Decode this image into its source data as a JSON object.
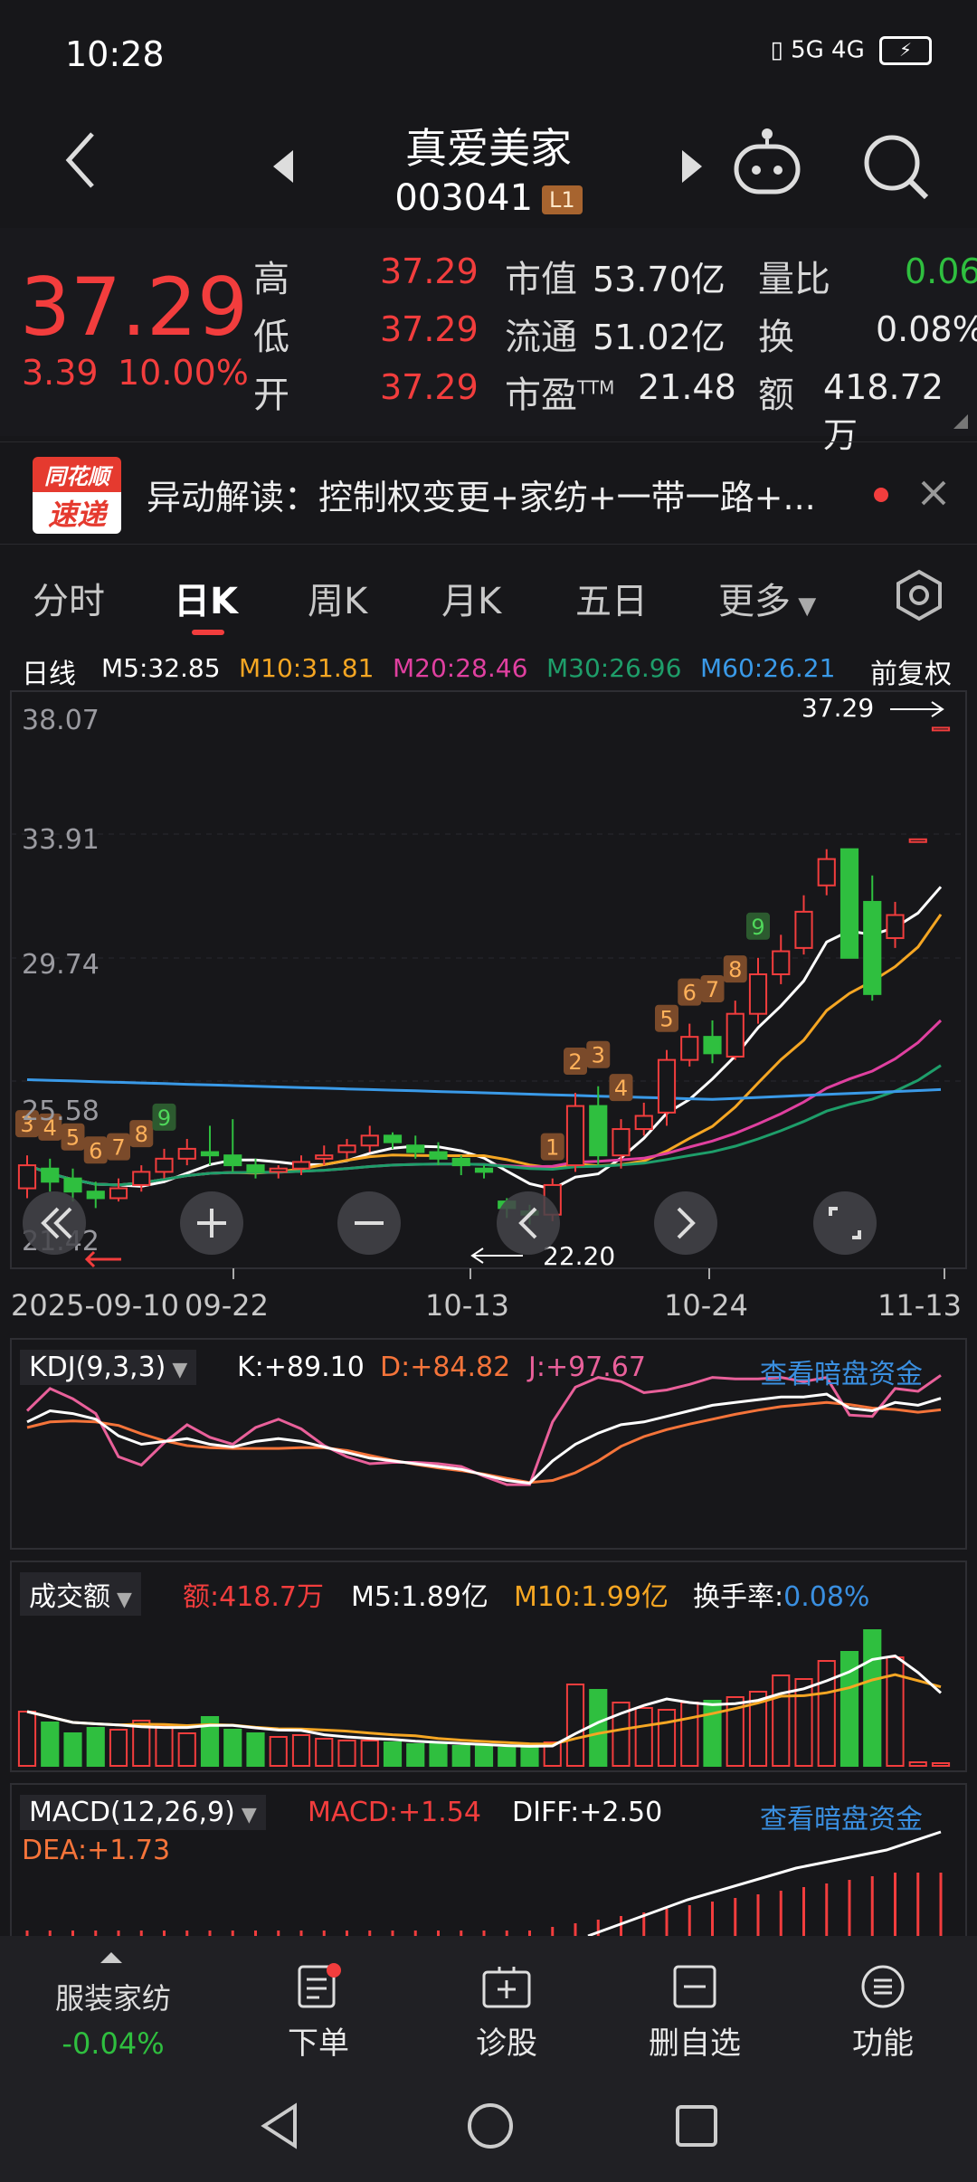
{
  "status": {
    "time": "10:28",
    "icons": "5G 4G"
  },
  "header": {
    "name": "真爱美家",
    "code": "003041",
    "badge": "L1"
  },
  "quote": {
    "price": "37.29",
    "change": "3.39",
    "change_pct": "10.00%",
    "rows": [
      {
        "l1": "高",
        "v1": "37.29",
        "l2": "市值",
        "v2": "53.70亿",
        "l3": "量比",
        "v3": "0.06"
      },
      {
        "l1": "低",
        "v1": "37.29",
        "l2": "流通",
        "v2": "51.02亿",
        "l3": "换",
        "v3": "0.08%"
      },
      {
        "l1": "开",
        "v1": "37.29",
        "l2": "市盈",
        "l2sup": "TTM",
        "v2": "21.48",
        "l3": "额",
        "v3": "418.72万"
      }
    ]
  },
  "news": {
    "brand_top": "同花顺",
    "brand_bottom": "速递",
    "text": "异动解读：控制权变更+家纺+一带一路+..."
  },
  "tabs": [
    "分时",
    "日K",
    "周K",
    "月K",
    "五日",
    "更多"
  ],
  "active_tab": "日K",
  "ma": {
    "label": "日线",
    "items": [
      {
        "text": "M5:32.85",
        "color": "#ffffff"
      },
      {
        "text": "M10:31.81",
        "color": "#f5a623"
      },
      {
        "text": "M20:28.46",
        "color": "#e040a0"
      },
      {
        "text": "M30:26.96",
        "color": "#1e9e6a"
      },
      {
        "text": "M60:26.21",
        "color": "#3a9ae8"
      }
    ],
    "adjust": "前复权"
  },
  "kchart": {
    "y_ticks": [
      "38.07",
      "33.91",
      "29.74",
      "25.58",
      "21.42"
    ],
    "x_ticks": [
      "2025-09-10",
      "09-22",
      "10-13",
      "10-24",
      "11-13"
    ],
    "high_label": "37.29",
    "low_label": "22.20"
  },
  "kdj": {
    "name": "KDJ(9,3,3)",
    "k": "K:+89.10",
    "d": "D:+84.82",
    "j": "J:+97.67",
    "link": "查看暗盘资金"
  },
  "volume": {
    "name": "成交额",
    "amount": "额:418.7万",
    "m5": "M5:1.89亿",
    "m10": "M10:1.99亿",
    "turnover_label": "换手率:",
    "turnover": "0.08%"
  },
  "macd": {
    "name": "MACD(12,26,9)",
    "macd": "MACD:+1.54",
    "diff": "DIFF:+2.50",
    "dea": "DEA:+1.73",
    "link": "查看暗盘资金"
  },
  "bottom_nav": {
    "sector": "服装家纺",
    "sector_change": "-0.04%",
    "items": [
      "下单",
      "诊股",
      "删自选",
      "功能"
    ]
  },
  "chart_data": {
    "type": "candlestick",
    "candles": [
      {
        "o": 23.3,
        "c": 24.0,
        "h": 24.3,
        "l": 23.0
      },
      {
        "o": 23.9,
        "c": 23.5,
        "h": 24.2,
        "l": 23.2
      },
      {
        "o": 23.6,
        "c": 23.2,
        "h": 23.9,
        "l": 22.9
      },
      {
        "o": 23.2,
        "c": 23.0,
        "h": 23.5,
        "l": 22.7
      },
      {
        "o": 23.0,
        "c": 23.3,
        "h": 23.6,
        "l": 22.9
      },
      {
        "o": 23.4,
        "c": 23.8,
        "h": 24.0,
        "l": 23.2
      },
      {
        "o": 23.8,
        "c": 24.2,
        "h": 24.5,
        "l": 23.6
      },
      {
        "o": 24.2,
        "c": 24.5,
        "h": 24.8,
        "l": 24.0
      },
      {
        "o": 24.4,
        "c": 24.3,
        "h": 25.2,
        "l": 24.0
      },
      {
        "o": 24.3,
        "c": 24.0,
        "h": 25.4,
        "l": 23.8
      },
      {
        "o": 24.0,
        "c": 23.8,
        "h": 24.2,
        "l": 23.6
      },
      {
        "o": 23.8,
        "c": 23.9,
        "h": 24.0,
        "l": 23.6
      },
      {
        "o": 23.9,
        "c": 24.1,
        "h": 24.3,
        "l": 23.7
      },
      {
        "o": 24.2,
        "c": 24.3,
        "h": 24.6,
        "l": 24.0
      },
      {
        "o": 24.4,
        "c": 24.6,
        "h": 24.8,
        "l": 24.2
      },
      {
        "o": 24.6,
        "c": 24.9,
        "h": 25.2,
        "l": 24.4
      },
      {
        "o": 24.9,
        "c": 24.7,
        "h": 25.0,
        "l": 24.5
      },
      {
        "o": 24.6,
        "c": 24.4,
        "h": 24.9,
        "l": 24.2
      },
      {
        "o": 24.4,
        "c": 24.2,
        "h": 24.7,
        "l": 24.0
      },
      {
        "o": 24.2,
        "c": 24.0,
        "h": 24.3,
        "l": 23.7
      },
      {
        "o": 23.9,
        "c": 23.8,
        "h": 24.0,
        "l": 23.6
      },
      {
        "o": 22.9,
        "c": 22.7,
        "h": 23.0,
        "l": 22.4
      },
      {
        "o": 22.6,
        "c": 22.5,
        "h": 22.8,
        "l": 22.2
      },
      {
        "o": 22.5,
        "c": 23.4,
        "h": 23.6,
        "l": 22.3
      },
      {
        "o": 24.0,
        "c": 25.8,
        "h": 26.2,
        "l": 23.8
      },
      {
        "o": 25.8,
        "c": 24.3,
        "h": 26.4,
        "l": 24.0
      },
      {
        "o": 24.3,
        "c": 25.1,
        "h": 25.4,
        "l": 23.9
      },
      {
        "o": 25.1,
        "c": 25.5,
        "h": 25.9,
        "l": 24.9
      },
      {
        "o": 25.6,
        "c": 27.2,
        "h": 27.5,
        "l": 25.2
      },
      {
        "o": 27.2,
        "c": 27.9,
        "h": 28.3,
        "l": 27.0
      },
      {
        "o": 27.9,
        "c": 27.4,
        "h": 28.4,
        "l": 27.1
      },
      {
        "o": 27.3,
        "c": 28.6,
        "h": 29.0,
        "l": 27.2
      },
      {
        "o": 28.6,
        "c": 29.8,
        "h": 30.3,
        "l": 28.3
      },
      {
        "o": 29.8,
        "c": 30.5,
        "h": 31.0,
        "l": 29.5
      },
      {
        "o": 30.6,
        "c": 31.7,
        "h": 32.2,
        "l": 30.4
      },
      {
        "o": 32.5,
        "c": 33.3,
        "h": 33.6,
        "l": 32.2
      },
      {
        "o": 33.6,
        "c": 30.3,
        "h": 33.6,
        "l": 30.3
      },
      {
        "o": 32.0,
        "c": 29.2,
        "h": 32.8,
        "l": 29.0
      },
      {
        "o": 30.9,
        "c": 31.6,
        "h": 32.0,
        "l": 30.6
      },
      {
        "o": 33.9,
        "c": 33.9,
        "h": 33.9,
        "l": 33.9
      },
      {
        "o": 37.29,
        "c": 37.29,
        "h": 37.29,
        "l": 37.29
      }
    ]
  }
}
